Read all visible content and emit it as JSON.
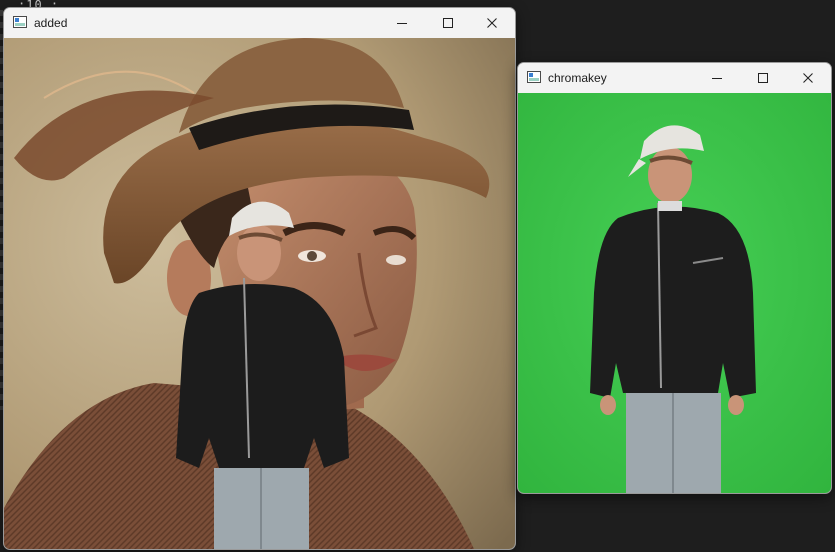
{
  "background": {
    "editor_snippet": ":10 :"
  },
  "windows": [
    {
      "title": "added",
      "controls": {
        "minimize": "minimize-icon",
        "maximize": "maximize-icon",
        "close": "close-icon"
      },
      "image_description_icon": "composite-image"
    },
    {
      "title": "chromakey",
      "controls": {
        "minimize": "minimize-icon",
        "maximize": "maximize-icon",
        "close": "close-icon"
      },
      "image_description_icon": "green-screen-image"
    }
  ],
  "colors": {
    "chroma_green": "#3cc24a",
    "title_bar": "#f3f3f3"
  }
}
